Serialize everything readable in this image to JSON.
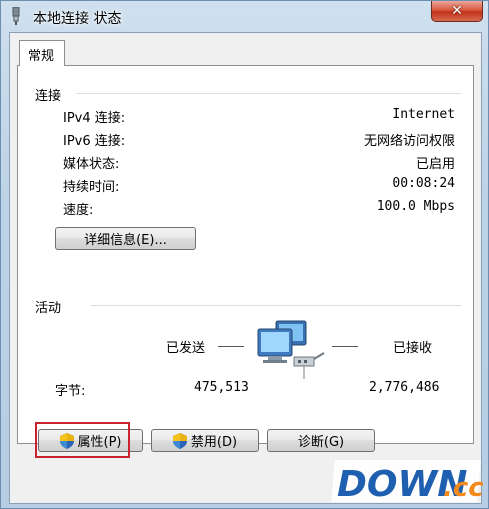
{
  "window": {
    "title": "本地连接 状态",
    "close_glyph": "✕"
  },
  "tabs": [
    {
      "label": "常规"
    }
  ],
  "connection": {
    "header": "连接",
    "rows": [
      {
        "label": "IPv4 连接:",
        "value": "Internet"
      },
      {
        "label": "IPv6 连接:",
        "value": "无网络访问权限"
      },
      {
        "label": "媒体状态:",
        "value": "已启用"
      },
      {
        "label": "持续时间:",
        "value": "00:08:24"
      },
      {
        "label": "速度:",
        "value": "100.0 Mbps"
      }
    ],
    "details_button": "详细信息(E)..."
  },
  "activity": {
    "header": "活动",
    "sent_label": "已发送",
    "received_label": "已接收",
    "bytes_label": "字节:",
    "sent_bytes": "475,513",
    "received_bytes": "2,776,486"
  },
  "buttons": {
    "properties": "属性(P)",
    "disable": "禁用(D)",
    "diagnose": "诊断(G)"
  },
  "watermark": {
    "text": "DOWN",
    "suffix": ".cc"
  },
  "colors": {
    "highlight_border": "#c8242c",
    "watermark_blue": "#1f5fb0",
    "watermark_orange": "#f28a1c"
  }
}
